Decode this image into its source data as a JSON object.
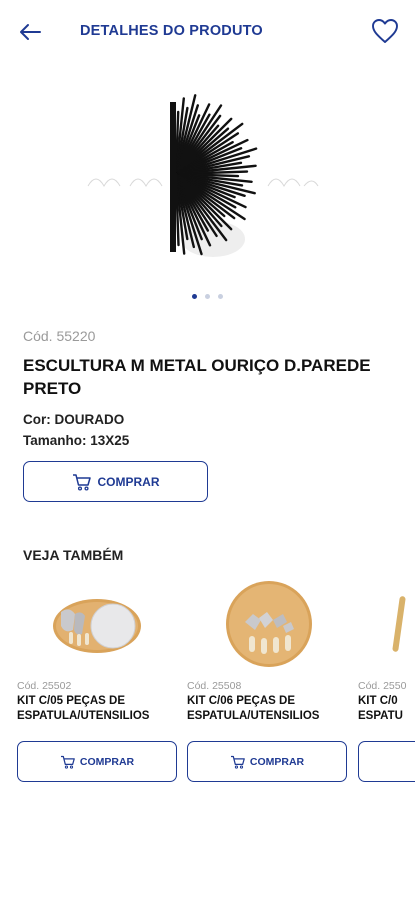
{
  "header": {
    "title": "DETALHES DO PRODUTO",
    "back_icon": "arrow-left-icon",
    "favorite_icon": "heart-outline-icon"
  },
  "colors": {
    "accent": "#1f3a93",
    "muted": "#9a9a9a"
  },
  "gallery": {
    "slide_count": 3,
    "active_slide": 1
  },
  "product": {
    "code": "Cód. 55220",
    "name": "ESCULTURA M METAL OURIÇO D.PAREDE PRETO",
    "color": "Cor: DOURADO",
    "size": "Tamanho: 13X25",
    "buy_label": "COMPRAR"
  },
  "related": {
    "title": "VEJA TAMBÉM",
    "items": [
      {
        "code": "Cód. 25502",
        "name": "KIT C/05 PEÇAS DE\nESPATULA/UTENSILIOS",
        "buy_label": "COMPRAR"
      },
      {
        "code": "Cód. 25508",
        "name": "KIT C/06 PEÇAS DE\nESPATULA/UTENSILIOS",
        "buy_label": "COMPRAR"
      },
      {
        "code": "Cód. 2550",
        "name": "KIT C/0\nESPATU",
        "buy_label": ""
      }
    ]
  }
}
